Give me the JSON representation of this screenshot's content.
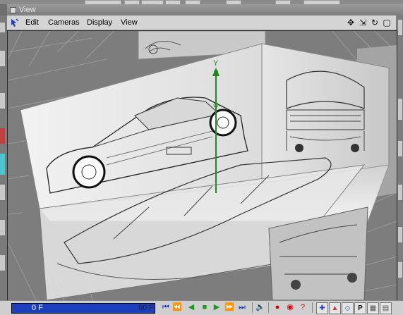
{
  "window": {
    "title": "View"
  },
  "menu": {
    "items": [
      "Edit",
      "Cameras",
      "Display",
      "View"
    ]
  },
  "nav_icons": [
    "move-icon",
    "zoom-icon",
    "rotate-icon",
    "maximize-icon"
  ],
  "viewport": {
    "axis_label": "Y"
  },
  "timeline": {
    "current_frame": "0 F",
    "end_frame": "90 F"
  },
  "colors": {
    "frame_field": "#1b3fbf",
    "play": "#1a9a1a",
    "record": "#dd0000",
    "axis": "#1c8a1c"
  }
}
